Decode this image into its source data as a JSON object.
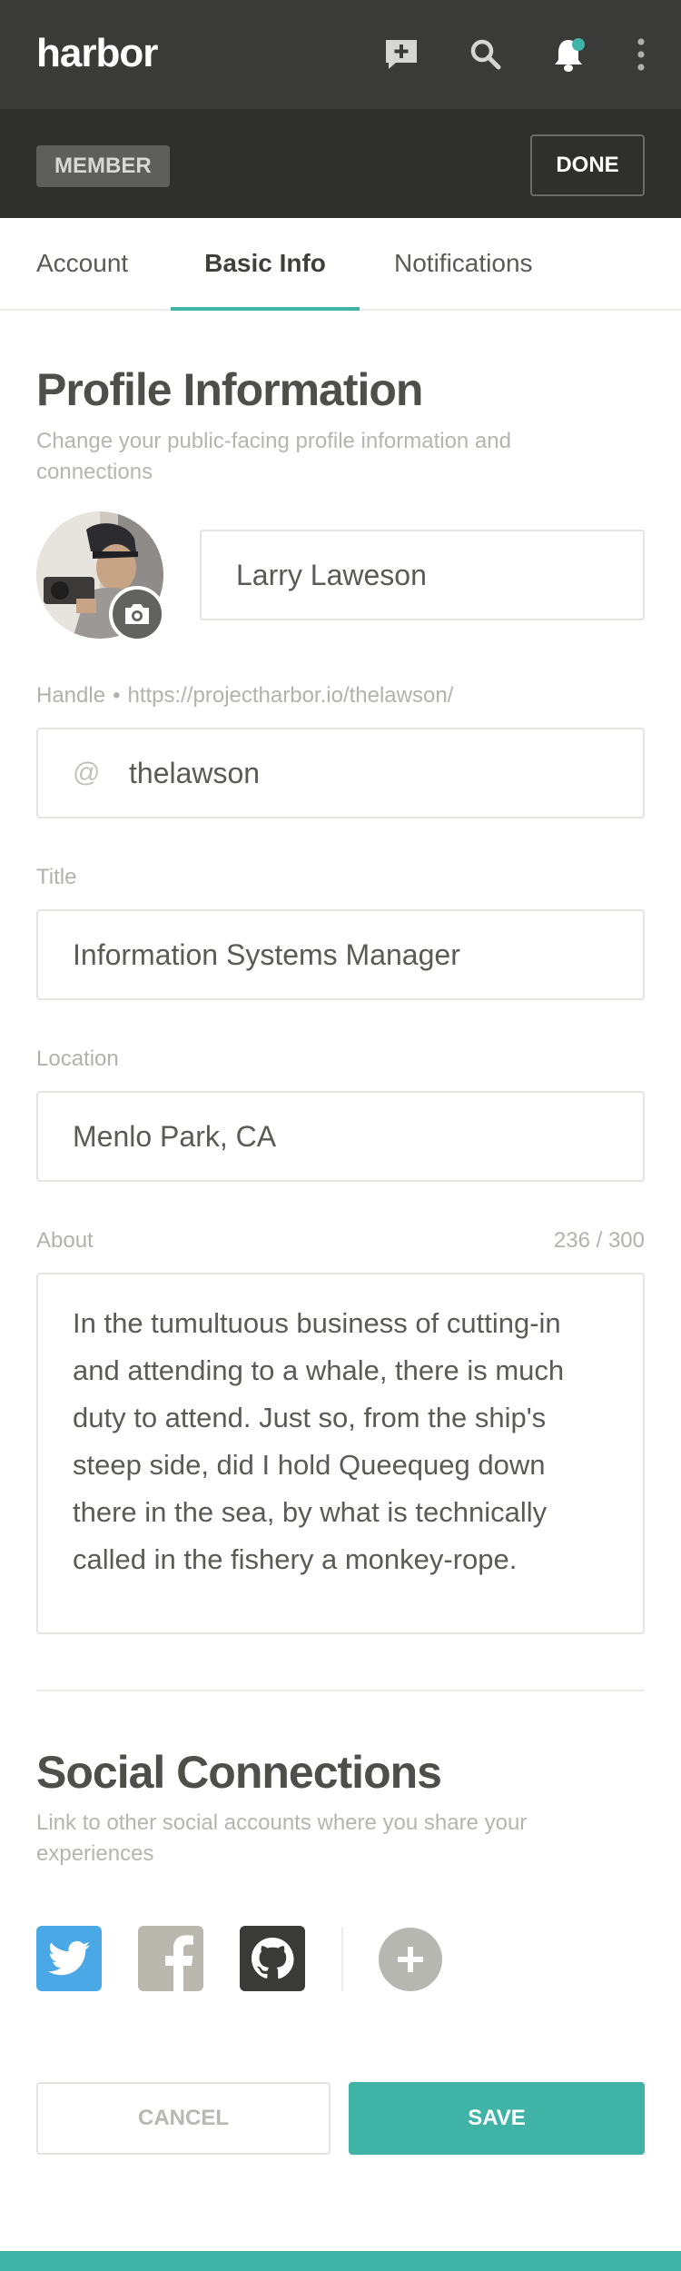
{
  "app": {
    "logo_text": "harbor"
  },
  "topbar_icons": [
    "message-icon",
    "search-icon",
    "bell-icon",
    "more-vert-icon"
  ],
  "subbar": {
    "badge": "MEMBER",
    "done_label": "DONE"
  },
  "tabs": [
    {
      "label": "Account",
      "active": false
    },
    {
      "label": "Basic Info",
      "active": true
    },
    {
      "label": "Notifications",
      "active": false
    }
  ],
  "profile": {
    "title": "Profile Information",
    "description": "Change your public-facing profile information and connections",
    "name": "Larry Laweson",
    "handle_label": "Handle",
    "handle_separator": "•",
    "handle_url": "https://projectharbor.io/thelawson/",
    "handle_prefix": "@",
    "handle": "thelawson",
    "title_label": "Title",
    "title_value": "Information Systems Manager",
    "location_label": "Location",
    "location_value": "Menlo Park, CA",
    "about_label": "About",
    "about_count": "236 / 300",
    "about_value": "In the tumultuous business of cutting-in and attending to a whale, there is much duty to attend. Just so, from the ship's steep side, did I hold Queequeg down there in the sea, by what is technically called in the fishery a monkey-rope."
  },
  "social": {
    "title": "Social Connections",
    "description": "Link to other social accounts where you share your experiences",
    "accounts": [
      {
        "icon": "twitter-icon",
        "color": "#4aa8e6"
      },
      {
        "icon": "facebook-icon",
        "color": "#bab7ae"
      },
      {
        "icon": "github-icon",
        "color": "#3a3a38"
      }
    ],
    "add_icon": "add-circle-icon"
  },
  "actions": {
    "cancel_label": "CANCEL",
    "save_label": "SAVE"
  },
  "colors": {
    "accent": "#3fb4a6",
    "appbar": "#3a3a38",
    "subbar": "#2f2f2d"
  }
}
